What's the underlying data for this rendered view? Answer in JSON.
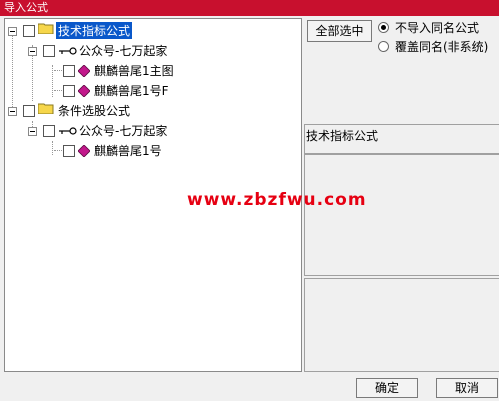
{
  "window": {
    "title": "导入公式"
  },
  "tree": {
    "nodes": [
      {
        "label": "技术指标公式",
        "selected": true
      },
      {
        "label": "公众号-七万起家"
      },
      {
        "label": "麒麟兽尾1主图"
      },
      {
        "label": "麒麟兽尾1号F"
      },
      {
        "label": "条件选股公式"
      },
      {
        "label": "公众号-七万起家"
      },
      {
        "label": "麒麟兽尾1号"
      }
    ]
  },
  "options": {
    "select_all_label": "全部选中",
    "radio_no_import": "不导入同名公式",
    "radio_overwrite": "覆盖同名(非系统)",
    "selected": "radio_no_import"
  },
  "info": {
    "title": "技术指标公式"
  },
  "watermark": "www.zbzfwu.com",
  "footer": {
    "ok_label": "确定",
    "cancel_label": "取消"
  },
  "colors": {
    "titlebar": "#c8102e",
    "selection": "#0a58ca",
    "watermark": "#e60012",
    "folder": "#f6d64a",
    "gem": "#c2188b"
  }
}
